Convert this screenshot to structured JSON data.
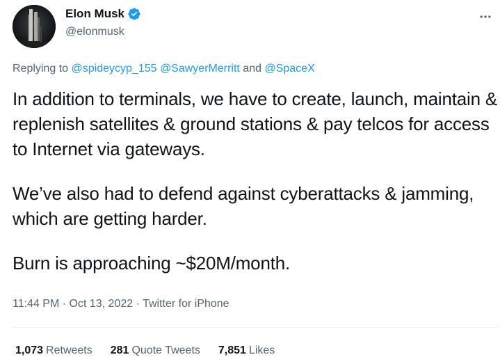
{
  "author": {
    "display_name": "Elon Musk",
    "handle": "@elonmusk",
    "verified": true,
    "avatar_icon": "avatar-rocket-photo",
    "verified_icon": "verified-badge-icon"
  },
  "menu": {
    "more_label": "..."
  },
  "reply": {
    "prefix": "Replying to ",
    "mentions": [
      "@spideycyp_155",
      "@SawyerMerritt",
      "@SpaceX"
    ],
    "joiner_and": " and "
  },
  "tweet": {
    "paragraphs": [
      "In addition to terminals, we have to create, launch, maintain & replenish satellites & ground stations & pay telcos for access to Internet via gateways.",
      "We’ve also had to defend against cyberattacks & jamming, which are getting harder.",
      "Burn is approaching ~$20M/month."
    ]
  },
  "meta": {
    "time": "11:44 PM",
    "separator": " · ",
    "date": "Oct 13, 2022",
    "source": "Twitter for iPhone"
  },
  "stats": {
    "retweets": {
      "count": "1,073",
      "label": "Retweets"
    },
    "quote_tweets": {
      "count": "281",
      "label": "Quote Tweets"
    },
    "likes": {
      "count": "7,851",
      "label": "Likes"
    }
  },
  "colors": {
    "link": "#1d9bf0",
    "secondary_text": "#536471",
    "primary_text": "#0f1419",
    "divider": "#eff3f4"
  }
}
